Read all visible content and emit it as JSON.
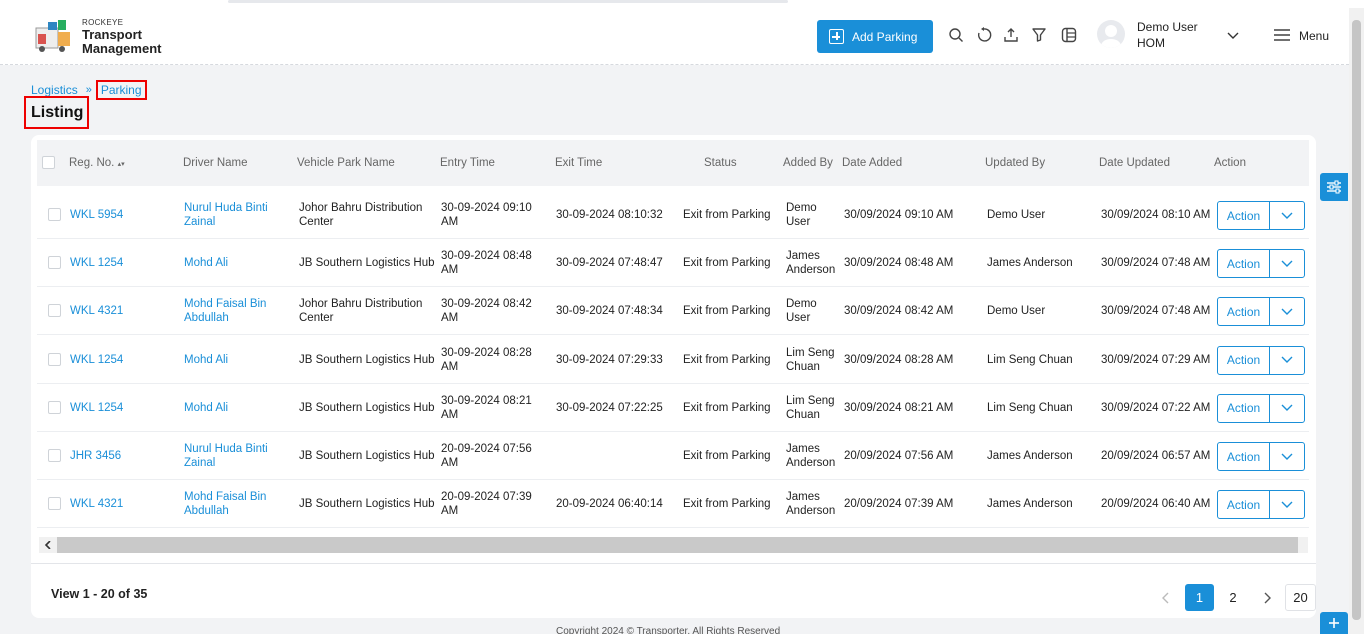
{
  "brand": {
    "small": "ROCKEYE",
    "line1": "Transport",
    "line2": "Management"
  },
  "header": {
    "add_button": "Add Parking",
    "icons": [
      "search-icon",
      "refresh-icon",
      "upload-icon",
      "filter-icon",
      "columns-icon"
    ],
    "user": {
      "name": "Demo User",
      "role": "HOM"
    },
    "menu_label": "Menu"
  },
  "breadcrumb": {
    "parent": "Logistics",
    "current": "Parking"
  },
  "page_title": "Listing",
  "table": {
    "columns": [
      "Reg. No.",
      "Driver Name",
      "Vehicle Park Name",
      "Entry Time",
      "Exit Time",
      "Status",
      "Added By",
      "Date Added",
      "Updated By",
      "Date Updated",
      "Action"
    ],
    "action_label": "Action",
    "rows": [
      {
        "reg": "WKL 5954",
        "driver": "Nurul Huda Binti Zainal",
        "park": "Johor Bahru Distribution Center",
        "entry": "30-09-2024 09:10 AM",
        "exit": "30-09-2024 08:10:32",
        "status": "Exit from Parking",
        "added_by": "Demo User",
        "date_added": "30/09/2024 09:10 AM",
        "updated_by": "Demo User",
        "date_updated": "30/09/2024 08:10 AM"
      },
      {
        "reg": "WKL 1254",
        "driver": "Mohd Ali",
        "park": "JB Southern Logistics Hub",
        "entry": "30-09-2024 08:48 AM",
        "exit": "30-09-2024 07:48:47",
        "status": "Exit from Parking",
        "added_by": "James Anderson",
        "date_added": "30/09/2024 08:48 AM",
        "updated_by": "James Anderson",
        "date_updated": "30/09/2024 07:48 AM"
      },
      {
        "reg": "WKL 4321",
        "driver": "Mohd Faisal Bin Abdullah",
        "park": "Johor Bahru Distribution Center",
        "entry": "30-09-2024 08:42 AM",
        "exit": "30-09-2024 07:48:34",
        "status": "Exit from Parking",
        "added_by": "Demo User",
        "date_added": "30/09/2024 08:42 AM",
        "updated_by": "Demo User",
        "date_updated": "30/09/2024 07:48 AM"
      },
      {
        "reg": "WKL 1254",
        "driver": "Mohd Ali",
        "park": "JB Southern Logistics Hub",
        "entry": "30-09-2024 08:28 AM",
        "exit": "30-09-2024 07:29:33",
        "status": "Exit from Parking",
        "added_by": "Lim Seng Chuan",
        "date_added": "30/09/2024 08:28 AM",
        "updated_by": "Lim Seng Chuan",
        "date_updated": "30/09/2024 07:29 AM"
      },
      {
        "reg": "WKL 1254",
        "driver": "Mohd Ali",
        "park": "JB Southern Logistics Hub",
        "entry": "30-09-2024 08:21 AM",
        "exit": "30-09-2024 07:22:25",
        "status": "Exit from Parking",
        "added_by": "Lim Seng Chuan",
        "date_added": "30/09/2024 08:21 AM",
        "updated_by": "Lim Seng Chuan",
        "date_updated": "30/09/2024 07:22 AM"
      },
      {
        "reg": "JHR 3456",
        "driver": "Nurul Huda Binti Zainal",
        "park": "JB Southern Logistics Hub",
        "entry": "20-09-2024 07:56 AM",
        "exit": "",
        "status": "Exit from Parking",
        "added_by": "James Anderson",
        "date_added": "20/09/2024 07:56 AM",
        "updated_by": "James Anderson",
        "date_updated": "20/09/2024 06:57 AM"
      },
      {
        "reg": "WKL 4321",
        "driver": "Mohd Faisal Bin Abdullah",
        "park": "JB Southern Logistics Hub",
        "entry": "20-09-2024 07:39 AM",
        "exit": "20-09-2024 06:40:14",
        "status": "Exit from Parking",
        "added_by": "James Anderson",
        "date_added": "20/09/2024 07:39 AM",
        "updated_by": "James Anderson",
        "date_updated": "20/09/2024 06:40 AM"
      }
    ]
  },
  "footer": {
    "view_info": "View 1 - 20 of 35",
    "pages": [
      "1",
      "2"
    ],
    "page_size": "20",
    "copyright": "Copyright 2024 © Transporter. All Rights Reserved"
  },
  "colors": {
    "accent": "#1a8fd8",
    "highlight": "#ee0000",
    "background": "#f2f3f5"
  }
}
